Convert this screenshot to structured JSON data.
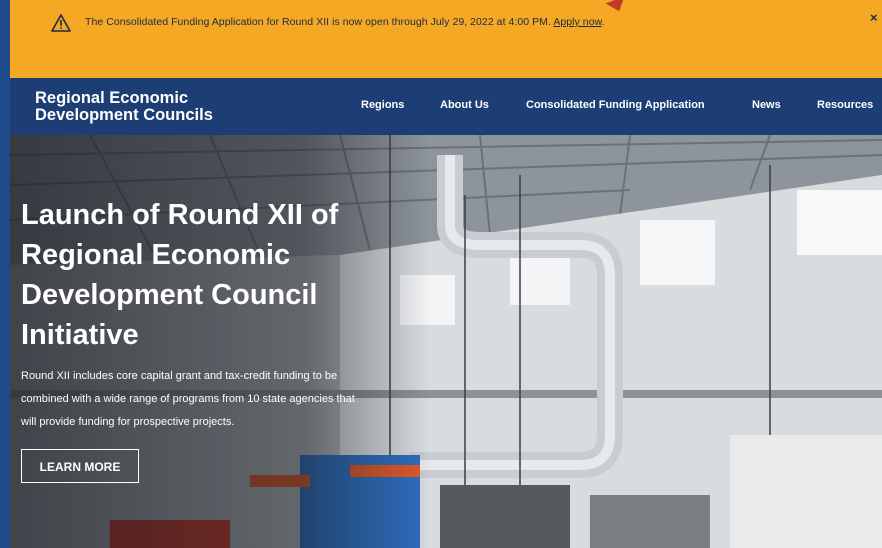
{
  "alert": {
    "icon": "warning-triangle-icon",
    "message": "The Consolidated Funding Application for Round XII is now open through July 29, 2022 at 4:00 PM.",
    "link_label": "Apply now",
    "close_label": "×",
    "background_color": "#f4a823"
  },
  "header": {
    "logo_line1": "Regional Economic",
    "logo_line2": "Development Councils",
    "background_color": "#1d3d75",
    "nav": [
      {
        "label": "Regions"
      },
      {
        "label": "About Us"
      },
      {
        "label": "Consolidated Funding Application"
      },
      {
        "label": "News"
      },
      {
        "label": "Resources"
      }
    ]
  },
  "hero": {
    "title": "Launch of Round XII of Regional Economic Development Council Initiative",
    "description": "Round XII includes core capital grant and tax-credit funding to be combined with a wide range of programs from 10 state agencies that will provide funding for prospective projects.",
    "button_label": "LEARN MORE"
  }
}
